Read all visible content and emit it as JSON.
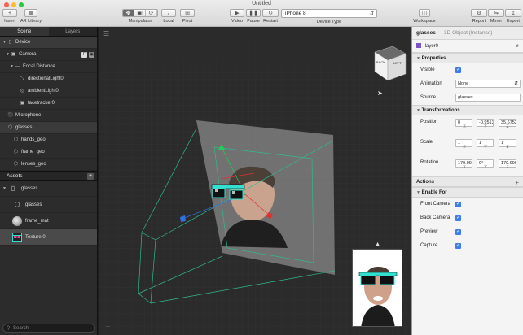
{
  "window": {
    "title": "Untitled"
  },
  "toolbar": {
    "insert": "Insert",
    "ar_library": "AR Library",
    "manipulator": "Manipulator",
    "local": "Local",
    "pivot": "Pivot",
    "video": "Video",
    "pause": "Pause",
    "restart": "Restart",
    "device_value": "iPhone 8",
    "device_type": "Device Type",
    "workspace": "Workspace",
    "report": "Report",
    "mirror": "Mirror",
    "export": "Export"
  },
  "left_panel": {
    "tabs": [
      "Scene",
      "Layers"
    ],
    "scene_items": [
      {
        "label": "Device"
      },
      {
        "label": "Camera"
      },
      {
        "label": "Focal Distance"
      },
      {
        "label": "directionalLight0"
      },
      {
        "label": "ambientLight0"
      },
      {
        "label": "facetracker0"
      },
      {
        "label": "Microphone"
      },
      {
        "label": "glasses"
      },
      {
        "label": "hands_geo"
      },
      {
        "label": "frame_geo"
      },
      {
        "label": "lenses_geo"
      }
    ],
    "assets_title": "Assets",
    "assets": [
      {
        "label": "glasses"
      },
      {
        "label": "glasses"
      },
      {
        "label": "frame_mat"
      },
      {
        "label": "Texture 0"
      }
    ],
    "search_placeholder": "Search"
  },
  "inspector": {
    "title": "glasses",
    "subtitle": "— 3D Object (Instance)",
    "layer": "layer0",
    "properties_title": "Properties",
    "visible_label": "Visible",
    "animation_label": "Animation",
    "animation_value": "None",
    "source_label": "Source",
    "source_value": "glasses",
    "transformations_title": "Transformations",
    "position_label": "Position",
    "position": [
      "0",
      "-0.9513",
      "35.6752"
    ],
    "scale_label": "Scale",
    "scale": [
      "1",
      "1",
      "1"
    ],
    "rotation_label": "Rotation",
    "rotation": [
      "179.999",
      "0°",
      "179.999"
    ],
    "axes": [
      "X",
      "Y",
      "Z"
    ],
    "actions_title": "Actions",
    "enable_for_title": "Enable For",
    "enable_for": [
      {
        "label": "Front Camera"
      },
      {
        "label": "Back Camera"
      },
      {
        "label": "Preview"
      },
      {
        "label": "Capture"
      }
    ]
  },
  "viewport": {
    "cube_back": "BACK",
    "cube_left": "LEFT"
  },
  "colors": {
    "accent": "#3d7ee8",
    "grid": "#3a3a3a",
    "glasses_frame": "#33e0d0"
  }
}
